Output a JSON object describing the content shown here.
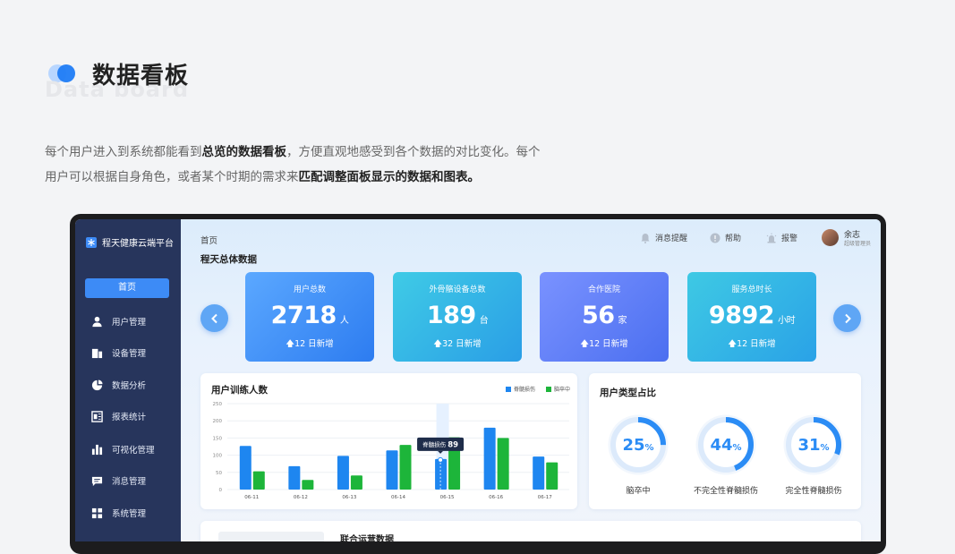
{
  "header": {
    "title": "数据看板",
    "subtitle_en": "Data board",
    "intro_line1_a": "每个用户进入到系统都能看到",
    "intro_line1_bold": "总览的数据看板",
    "intro_line1_b": "，方便直观地感受到各个数据的对比变化。每个",
    "intro_line2_a": "用户可以根据自身角色，或者某个时期的需求来",
    "intro_line2_bold": "匹配调整面板显示的数据和图表。"
  },
  "app": {
    "brand": "程天健康云端平台",
    "sidebar": {
      "home": "首页",
      "items": [
        {
          "label": "用户管理",
          "icon": "user-icon"
        },
        {
          "label": "设备管理",
          "icon": "device-icon"
        },
        {
          "label": "数据分析",
          "icon": "pie-icon"
        },
        {
          "label": "报表统计",
          "icon": "report-icon"
        },
        {
          "label": "可视化管理",
          "icon": "bar-icon"
        },
        {
          "label": "消息管理",
          "icon": "message-icon"
        },
        {
          "label": "系统管理",
          "icon": "grid-icon"
        }
      ]
    },
    "breadcrumb": "首页",
    "section_title": "程天总体数据",
    "topbar": {
      "notice": "消息提醒",
      "help": "帮助",
      "alarm": "报警",
      "user_name": "余志",
      "user_role": "超级管理员"
    },
    "stats": [
      {
        "label": "用户总数",
        "value": "2718",
        "unit": "人",
        "foot": "12 日新增",
        "color_from": "#5ba8ff",
        "color_to": "#2d7cf0"
      },
      {
        "label": "外骨骼设备总数",
        "value": "189",
        "unit": "台",
        "foot": "32 日新增",
        "color_from": "#3fcbe6",
        "color_to": "#2a9ee6"
      },
      {
        "label": "合作医院",
        "value": "56",
        "unit": "家",
        "foot": "12 日新增",
        "color_from": "#7a92ff",
        "color_to": "#4b6ff0"
      },
      {
        "label": "服务总时长",
        "value": "9892",
        "unit": "小时",
        "foot": "12 日新增",
        "color_from": "#3ec9e4",
        "color_to": "#2aa2e7"
      }
    ],
    "train_card": {
      "title": "用户训练人数",
      "legend_a": "脊髓损伤",
      "legend_b": "脑卒中",
      "tooltip_label": "脊髓损伤",
      "tooltip_value": "89"
    },
    "type_card": {
      "title": "用户类型占比",
      "rings": [
        {
          "label": "脑卒中",
          "value": "25",
          "pct": 0.25
        },
        {
          "label": "不完全性脊髓损伤",
          "value": "44",
          "pct": 0.44
        },
        {
          "label": "完全性脊髓损伤",
          "value": "31",
          "pct": 0.31
        }
      ],
      "unit": "%"
    },
    "third_card_title": "联合运营数据"
  },
  "colors": {
    "blue": "#1e86f0",
    "green": "#1db53a",
    "ring": "#2b8cf5",
    "ring_bg": "#dceafb"
  },
  "chart_data": {
    "type": "bar",
    "categories": [
      "06-11",
      "06-12",
      "06-13",
      "06-14",
      "06-15",
      "06-16",
      "06-17"
    ],
    "series": [
      {
        "name": "脊髓损伤",
        "values": [
          127,
          68,
          98,
          114,
          89,
          180,
          96
        ]
      },
      {
        "name": "脑卒中",
        "values": [
          53,
          28,
          41,
          130,
          152,
          150,
          79
        ]
      }
    ],
    "yticks": [
      0,
      50,
      100,
      150,
      200,
      250
    ],
    "ylim": [
      0,
      250
    ],
    "highlight_index": 4
  }
}
